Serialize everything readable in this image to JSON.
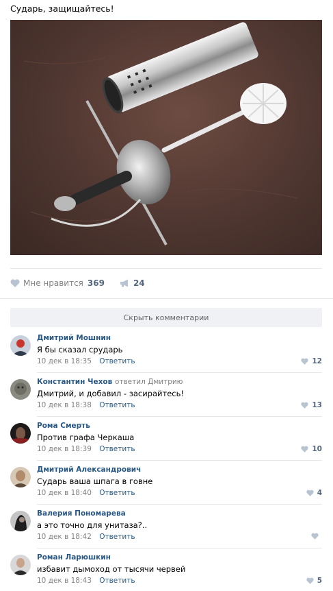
{
  "post": {
    "text": "Сударь, защищайтесь!",
    "image_icon": "photo-rapier-toilet-brush"
  },
  "actions": {
    "like_label": "Мне нравится",
    "like_count": "369",
    "share_count": "24"
  },
  "hide_comments_label": "Скрыть комментарии",
  "comments": [
    {
      "author": "Дмитрий Мошнин",
      "reply_to": "",
      "text": "Я бы сказал срударь",
      "date": "10 дек в 18:35",
      "reply_label": "Ответить",
      "likes": "12"
    },
    {
      "author": "Константин Чехов",
      "reply_to": "ответил Дмитрию",
      "text": "Дмитрий, и добавил - засирайтесь!",
      "date": "10 дек в 18:38",
      "reply_label": "Ответить",
      "likes": "13"
    },
    {
      "author": "Рома Смерть",
      "reply_to": "",
      "text": "Против графа Черкаша",
      "date": "10 дек в 18:39",
      "reply_label": "Ответить",
      "likes": "10"
    },
    {
      "author": "Дмитрий Александрович",
      "reply_to": "",
      "text": "Сударь ваша шпага в говне",
      "date": "10 дек в 18:40",
      "reply_label": "Ответить",
      "likes": "4"
    },
    {
      "author": "Валерия Пономарева",
      "reply_to": "",
      "text": "а это точно для унитаза?..",
      "date": "10 дек в 18:42",
      "reply_label": "Ответить",
      "likes": ""
    },
    {
      "author": "Роман Ларюшкин",
      "reply_to": "",
      "text": "избавит дымоход от тысячи червей",
      "date": "10 дек в 18:43",
      "reply_label": "Ответить",
      "likes": "5"
    }
  ],
  "colors": {
    "link": "#2a5885",
    "meta": "#828282",
    "count": "#55677d",
    "divider": "#e7e8ec",
    "button_bg": "#eff1f4"
  }
}
